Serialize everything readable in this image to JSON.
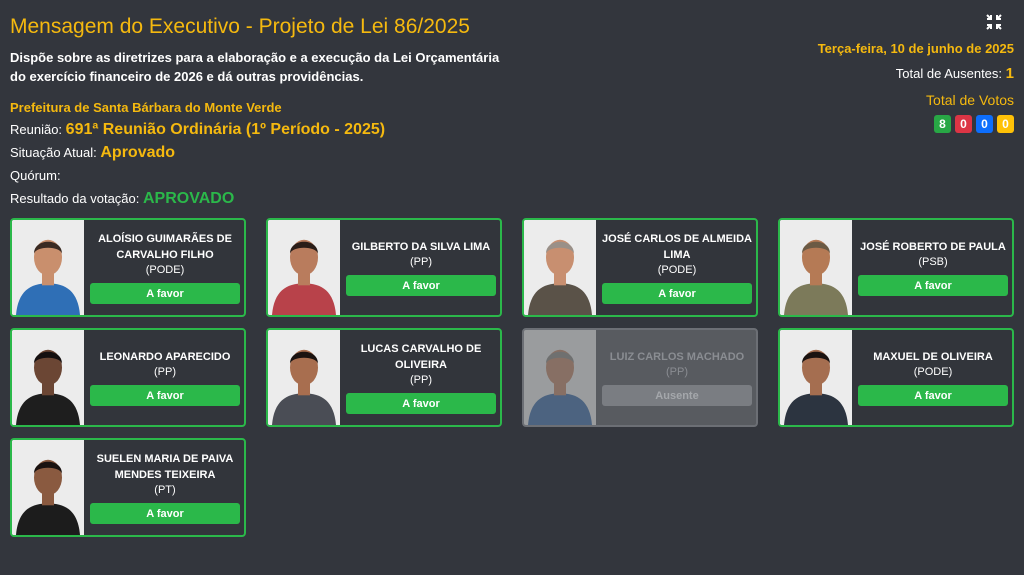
{
  "header": {
    "title": "Mensagem do Executivo - Projeto de Lei 86/2025",
    "subtitle": "Dispõe sobre as diretrizes para a elaboração e a execução da Lei Orçamentária do exercício financeiro de 2026 e dá outras providências.",
    "organization": "Prefeitura de Santa Bárbara do Monte Verde",
    "meeting_label": "Reunião:",
    "meeting_value": "691ª Reunião Ordinária (1º Período - 2025)",
    "situation_label": "Situação Atual:",
    "situation_value": "Aprovado",
    "quorum_label": "Quórum:",
    "quorum_value": "",
    "result_label": "Resultado da votação:",
    "result_value": "APROVADO"
  },
  "side": {
    "date": "Terça-feira, 10 de junho de 2025",
    "absent_label": "Total de Ausentes:",
    "absent_count": "1",
    "votes_title": "Total de Votos",
    "votes": {
      "favor": "8",
      "contra": "0",
      "abstencao": "0",
      "outros": "0"
    },
    "collapse_icon": "compress-icon"
  },
  "colors": {
    "accent": "#f5b90f",
    "favor": "#2bb84a",
    "background": "#33363d"
  },
  "councilors": [
    {
      "name": "ALOÍSIO GUIMARÃES DE CARVALHO FILHO",
      "party": "(PODE)",
      "status": "A favor",
      "shirt": "#2f6fb6",
      "skin": "#c98f6d",
      "hair": "#3a2a22"
    },
    {
      "name": "GILBERTO DA SILVA LIMA",
      "party": "(PP)",
      "status": "A favor",
      "shirt": "#b8424a",
      "skin": "#b97c5d",
      "hair": "#2a1d18"
    },
    {
      "name": "JOSÉ CARLOS DE ALMEIDA LIMA",
      "party": "(PODE)",
      "status": "A favor",
      "shirt": "#5a5248",
      "skin": "#c88f70",
      "hair": "#9a9088"
    },
    {
      "name": "JOSÉ ROBERTO DE PAULA",
      "party": "(PSB)",
      "status": "A favor",
      "shirt": "#7c7a5a",
      "skin": "#b57a55",
      "hair": "#6b5a44"
    },
    {
      "name": "LEONARDO APARECIDO",
      "party": "(PP)",
      "status": "A favor",
      "shirt": "#1e1e1e",
      "skin": "#6b4634",
      "hair": "#151010"
    },
    {
      "name": "LUCAS CARVALHO DE OLIVEIRA",
      "party": "(PP)",
      "status": "A favor",
      "shirt": "#4a4d55",
      "skin": "#a86e4f",
      "hair": "#1a1210"
    },
    {
      "name": "LUIZ CARLOS MACHADO",
      "party": "(PP)",
      "status": "Ausente",
      "shirt": "#3f6ea8",
      "skin": "#c0876a",
      "hair": "#8c8a86"
    },
    {
      "name": "MAXUEL DE OLIVEIRA",
      "party": "(PODE)",
      "status": "A favor",
      "shirt": "#2c3440",
      "skin": "#a56e50",
      "hair": "#1a1210"
    },
    {
      "name": "SUELEN MARIA DE PAIVA MENDES TEIXEIRA",
      "party": "(PT)",
      "status": "A favor",
      "shirt": "#1c1c1c",
      "skin": "#8a5a40",
      "hair": "#1a1210"
    }
  ]
}
